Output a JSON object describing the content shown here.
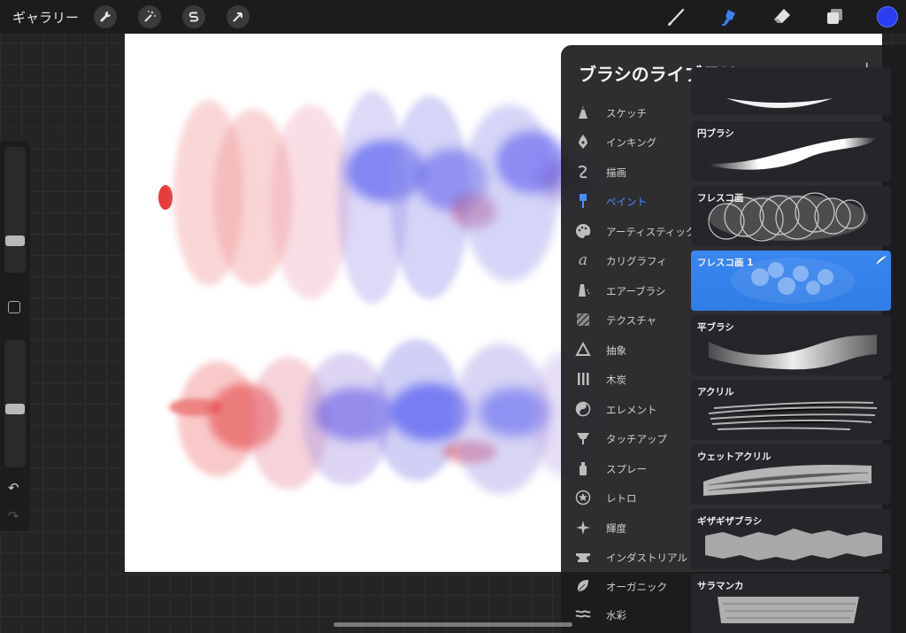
{
  "topbar": {
    "gallery_label": "ギャラリー",
    "active_color": "#2a3df2"
  },
  "panel": {
    "title": "ブラシのライブラリ",
    "add_label": "+",
    "categories": [
      {
        "label": "スケッチ",
        "icon": "pencil-tip-icon"
      },
      {
        "label": "インキング",
        "icon": "pen-nib-icon"
      },
      {
        "label": "描画",
        "icon": "curve-icon"
      },
      {
        "label": "ペイント",
        "icon": "paint-brush-icon",
        "active": true
      },
      {
        "label": "アーティスティック",
        "icon": "palette-icon"
      },
      {
        "label": "カリグラフィ",
        "icon": "calligraphy-icon"
      },
      {
        "label": "エアーブラシ",
        "icon": "airbrush-icon"
      },
      {
        "label": "テクスチャ",
        "icon": "texture-icon"
      },
      {
        "label": "抽象",
        "icon": "triangle-icon"
      },
      {
        "label": "木炭",
        "icon": "charcoal-icon"
      },
      {
        "label": "エレメント",
        "icon": "yin-yang-icon"
      },
      {
        "label": "タッチアップ",
        "icon": "touchup-icon"
      },
      {
        "label": "スプレー",
        "icon": "spray-can-icon"
      },
      {
        "label": "レトロ",
        "icon": "star-circle-icon"
      },
      {
        "label": "輝度",
        "icon": "sparkle-icon"
      },
      {
        "label": "インダストリアル",
        "icon": "anvil-icon"
      },
      {
        "label": "オーガニック",
        "icon": "leaf-icon"
      },
      {
        "label": "水彩",
        "icon": "waves-icon"
      }
    ],
    "brushes": [
      {
        "name": ""
      },
      {
        "name": "円ブラシ"
      },
      {
        "name": "フレスコ画"
      },
      {
        "name": "フレスコ画 1",
        "selected": true
      },
      {
        "name": "平ブラシ"
      },
      {
        "name": "アクリル"
      },
      {
        "name": "ウェットアクリル"
      },
      {
        "name": "ギザギザブラシ"
      },
      {
        "name": "サラマンカ"
      }
    ]
  },
  "colors": {
    "accent": "#4a8cff",
    "selected_brush_bg": "#3a86f0",
    "paint_red": "#e84a4a",
    "paint_blue": "#3c46f0"
  }
}
